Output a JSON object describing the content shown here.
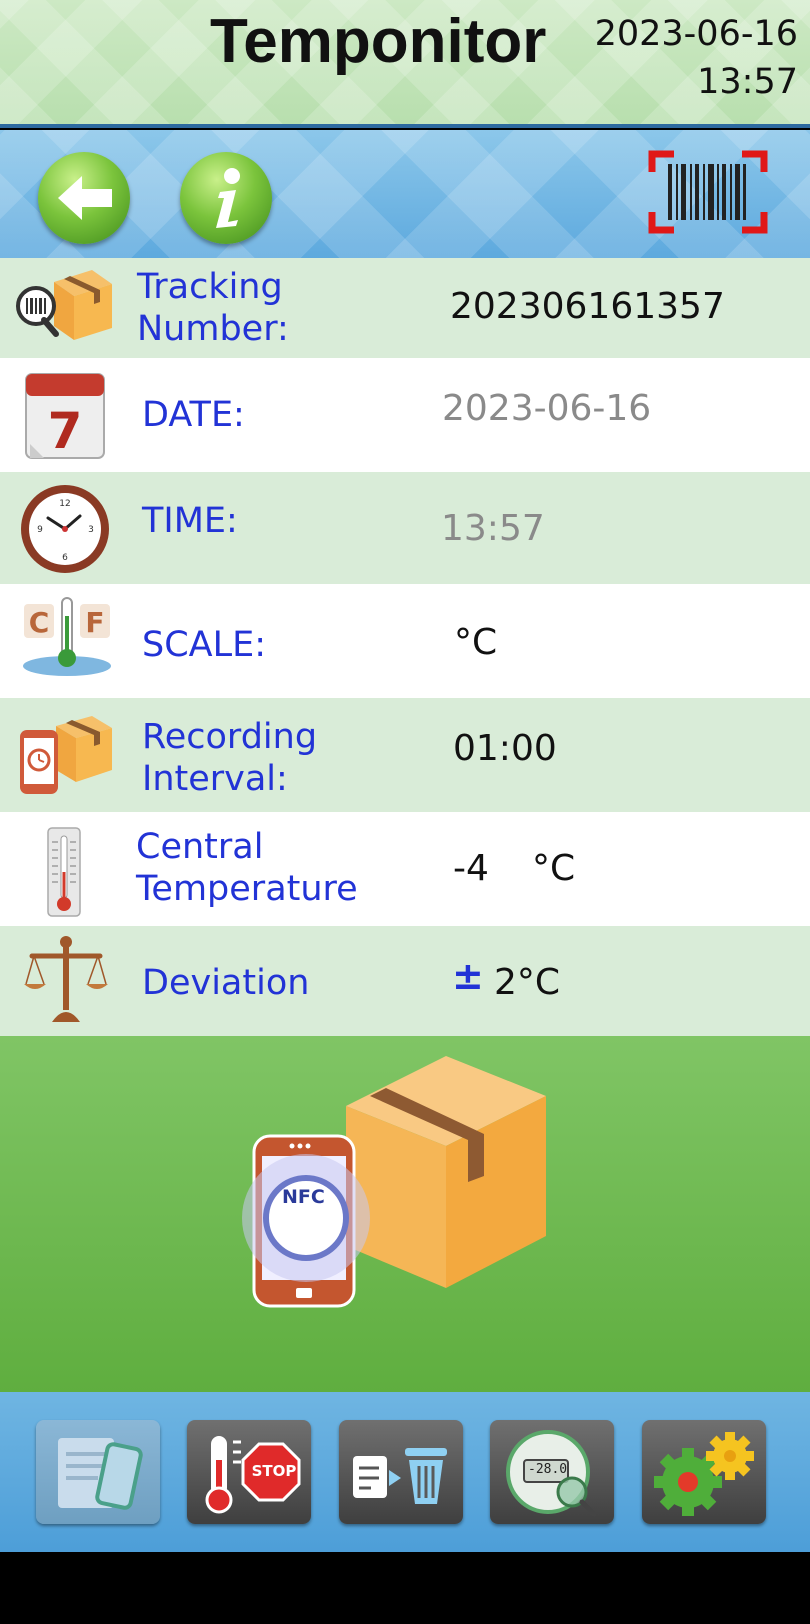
{
  "header": {
    "title": "Temponitor",
    "date": "2023-06-16",
    "time": "13:57"
  },
  "toolbar": {
    "back_icon": "back-arrow-icon",
    "info_icon": "info-icon",
    "scan_icon": "barcode-scan-icon"
  },
  "rows": {
    "tracking": {
      "label_line1": "Tracking",
      "label_line2": "Number:",
      "value": "202306161357"
    },
    "date": {
      "label": "DATE:",
      "value": "2023-06-16"
    },
    "time": {
      "label": "TIME:",
      "value": "13:57"
    },
    "scale": {
      "label": "SCALE:",
      "value": "°C"
    },
    "interval": {
      "label_line1": "Recording",
      "label_line2": "Interval:",
      "value": "01:00"
    },
    "central": {
      "label_line1": "Central",
      "label_line2": "Temperature",
      "value": "-4",
      "unit": "°C"
    },
    "deviation": {
      "label": "Deviation",
      "symbol": "±",
      "value": "2°C"
    }
  },
  "nfc": {
    "badge": "NFC"
  },
  "bottom": {
    "stop_label": "STOP",
    "meter_reading": "-28.0"
  },
  "colors": {
    "label_blue": "#2233d6",
    "alt_row": "#d9ecd8",
    "green_area": "#6ab84e",
    "bottom_blue": "#5aa7dc"
  }
}
